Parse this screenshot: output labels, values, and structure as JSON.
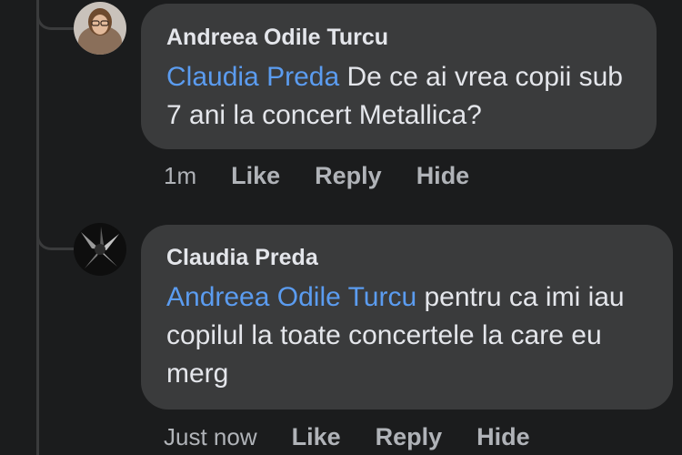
{
  "comments": [
    {
      "author": "Andreea Odile Turcu",
      "mention": "Claudia Preda",
      "text": " De ce ai vrea copii sub 7 ani la concert Metallica?",
      "time": "1m",
      "actions": [
        "Like",
        "Reply",
        "Hide"
      ]
    },
    {
      "author": "Claudia Preda",
      "mention": "Andreea Odile Turcu",
      "text": " pentru ca imi iau copilul la toate concertele la care eu merg",
      "time": "Just now",
      "actions": [
        "Like",
        "Reply",
        "Hide"
      ]
    }
  ],
  "colors": {
    "background": "#1b1c1d",
    "bubble": "#3a3b3c",
    "mention": "#5b9cf0",
    "text": "#e4e6eb",
    "muted": "#b0b3b8"
  }
}
